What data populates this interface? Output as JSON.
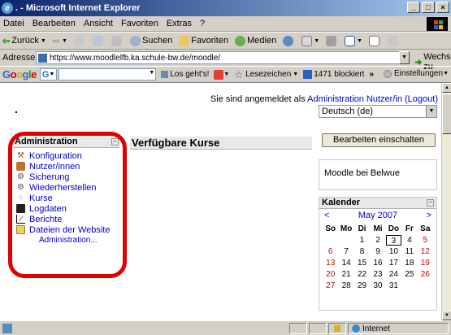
{
  "window": {
    "title": ". - Microsoft Internet Explorer",
    "minimize": "_",
    "maximize": "□",
    "close": "×"
  },
  "menu": [
    "Datei",
    "Bearbeiten",
    "Ansicht",
    "Favoriten",
    "Extras",
    "?"
  ],
  "toolbar": {
    "back": "Zurück",
    "search": "Suchen",
    "favorites": "Favoriten",
    "media": "Medien"
  },
  "address": {
    "label": "Adresse",
    "url": "https://www.moodlelfb.ka.schule-bw.de/moodle/",
    "go": "Wechseln zu"
  },
  "googlebar": {
    "logo": [
      "G",
      "o",
      "o",
      "g",
      "l",
      "e"
    ],
    "btn": "G",
    "go": "Los geht's!",
    "bookmarks": "Lesezeichen",
    "blocked": "1471 blockiert",
    "more": "»",
    "settings": "Einstellungen"
  },
  "page": {
    "dot": ".",
    "login_prefix": "Sie sind angemeldet als",
    "login_user": "Administration Nutzer/in",
    "logout": "(Logout)",
    "language": "Deutsch (de)"
  },
  "admin": {
    "title": "Administration",
    "items": [
      {
        "label": "Konfiguration",
        "icon": "hammer-icon"
      },
      {
        "label": "Nutzer/innen",
        "icon": "users-icon"
      },
      {
        "label": "Sicherung",
        "icon": "backup-icon"
      },
      {
        "label": "Wiederherstellen",
        "icon": "restore-icon"
      },
      {
        "label": "Kurse",
        "icon": "courses-icon"
      },
      {
        "label": "Logdaten",
        "icon": "logs-icon"
      },
      {
        "label": "Berichte",
        "icon": "chart-icon"
      },
      {
        "label": "Dateien der Website",
        "icon": "folder-icon"
      }
    ],
    "more": "Administration..."
  },
  "courses": {
    "title": "Verfügbare Kurse"
  },
  "right": {
    "edit_button": "Bearbeiten einschalten",
    "site_name": "Moodle bei Belwue"
  },
  "calendar": {
    "title": "Kalender",
    "prev": "<",
    "month": "May 2007",
    "next": ">",
    "days": [
      "So",
      "Mo",
      "Di",
      "Mi",
      "Do",
      "Fr",
      "Sa"
    ],
    "weeks": [
      [
        "",
        "",
        "1",
        "2",
        "3",
        "4",
        "5"
      ],
      [
        "6",
        "7",
        "8",
        "9",
        "10",
        "11",
        "12"
      ],
      [
        "13",
        "14",
        "15",
        "16",
        "17",
        "18",
        "19"
      ],
      [
        "20",
        "21",
        "22",
        "23",
        "24",
        "25",
        "26"
      ],
      [
        "27",
        "28",
        "29",
        "30",
        "31",
        "",
        ""
      ]
    ],
    "today": "3"
  },
  "status": {
    "zone": "Internet"
  }
}
